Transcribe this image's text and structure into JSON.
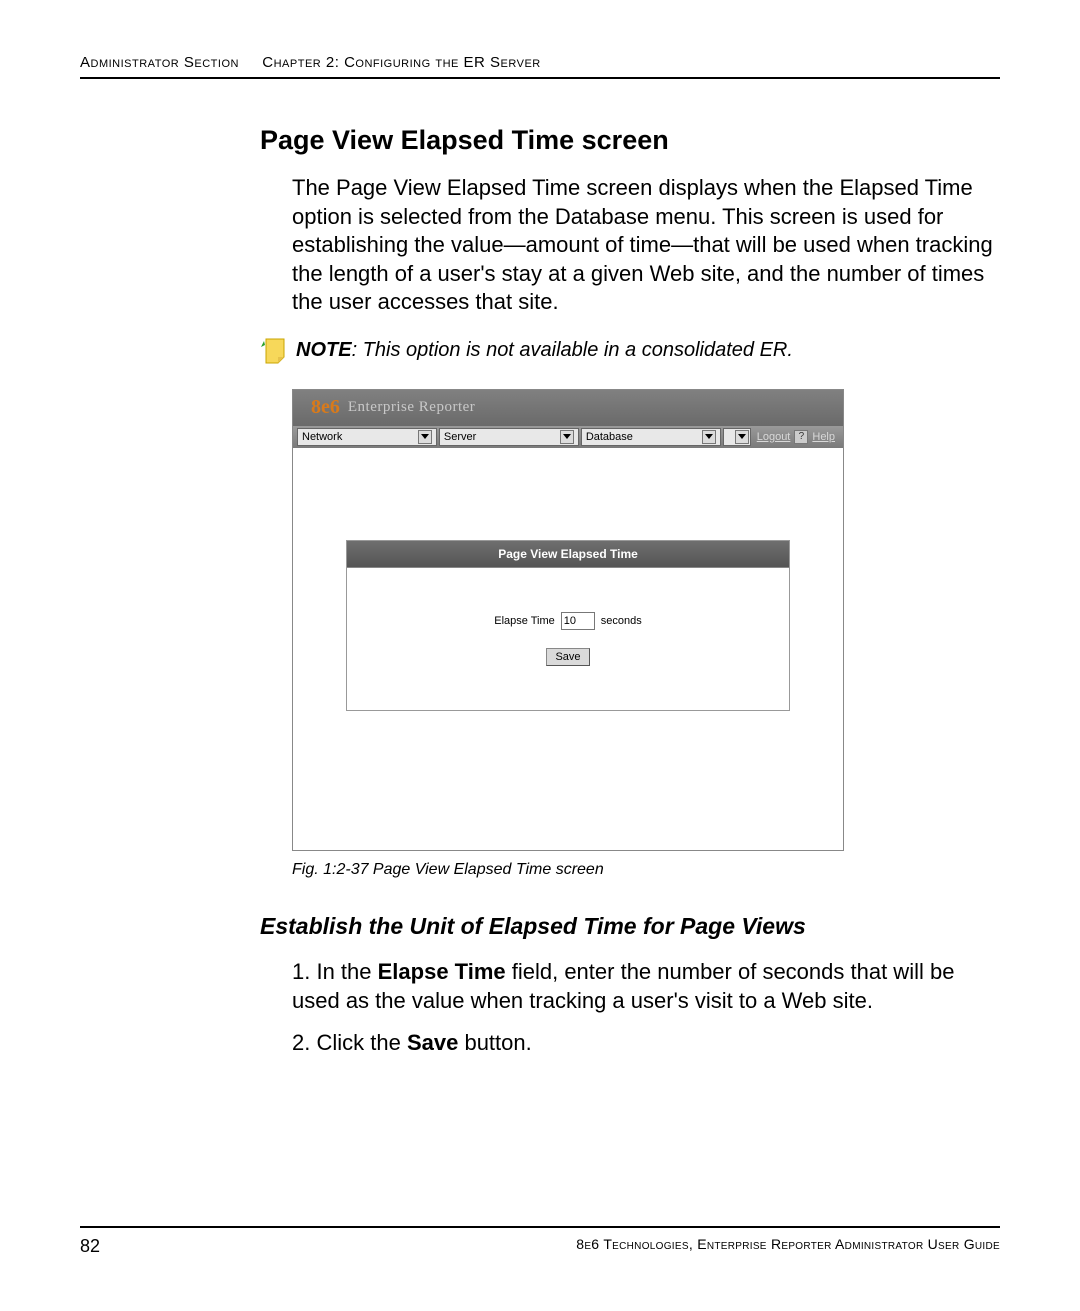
{
  "header": {
    "section": "Administrator Section",
    "chapter": "Chapter 2: Configuring the ER Server"
  },
  "h2": "Page View Elapsed Time screen",
  "intro": "The Page View Elapsed Time screen displays when the Elapsed Time option is selected from the Database menu. This screen is used for establishing the value—amount of time—that will be used when tracking the length of a user's stay at a given Web site, and the number of times the user accesses that site.",
  "note_label": "NOTE",
  "note_text": ": This option is not available in a consolidated ER.",
  "screenshot": {
    "logo_brand": "8e6",
    "logo_sub": "Enterprise Reporter",
    "menus": [
      "Network",
      "Server",
      "Database"
    ],
    "logout": "Logout",
    "help_q": "?",
    "help": "Help",
    "panel_title": "Page View Elapsed Time",
    "field_label": "Elapse Time",
    "field_value": "10",
    "field_unit": "seconds",
    "save": "Save"
  },
  "fig_caption": "Fig. 1:2-37  Page View Elapsed Time screen",
  "h3": "Establish the Unit of Elapsed Time for Page Views",
  "steps": {
    "s1_num": "1. ",
    "s1_a": "In the ",
    "s1_b": "Elapse Time",
    "s1_c": " field, enter the number of seconds that will be used as the value when tracking a user's visit to a Web site.",
    "s2_num": "2. ",
    "s2_a": "Click the ",
    "s2_b": "Save",
    "s2_c": " button."
  },
  "footer": {
    "page": "82",
    "text": "8e6 Technologies, Enterprise Reporter Administrator User Guide"
  }
}
